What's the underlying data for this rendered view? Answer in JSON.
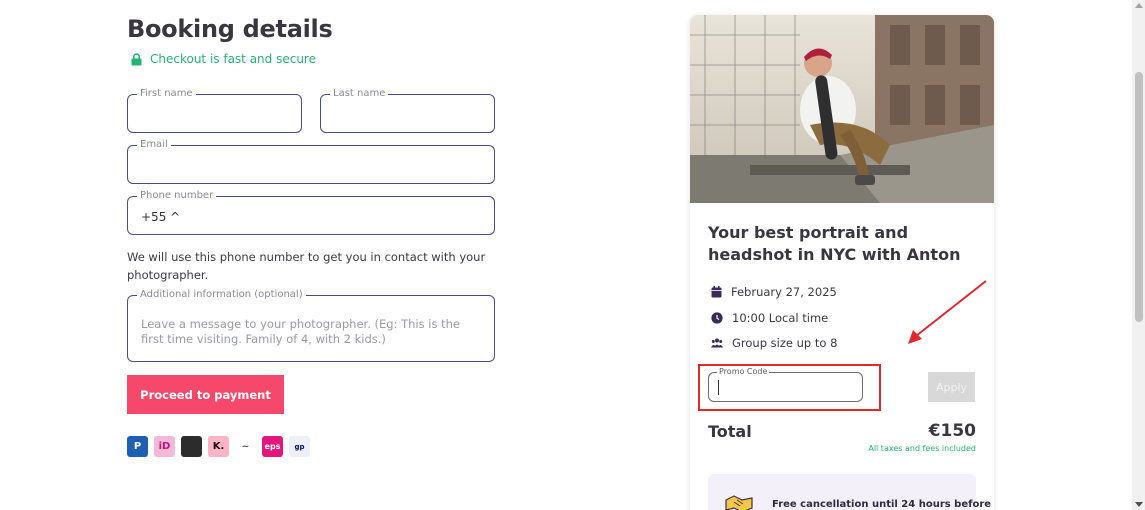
{
  "form": {
    "title": "Booking details",
    "secure_text": "Checkout is fast and secure",
    "first_name": {
      "label": "First name",
      "value": ""
    },
    "last_name": {
      "label": "Last name",
      "value": ""
    },
    "email": {
      "label": "Email",
      "value": ""
    },
    "phone": {
      "label": "Phone number",
      "country_code": "+55 ^"
    },
    "phone_helper": "We will use this phone number to get you in contact with your photographer.",
    "additional_info": {
      "label": "Additional information (optional)",
      "placeholder": "Leave a message to your photographer. (Eg: This is the first time visiting. Family of 4, with 2 kids.)"
    },
    "proceed_label": "Proceed to payment",
    "payment_methods": [
      {
        "name": "paypal-icon",
        "glyph": "P"
      },
      {
        "name": "ideal-icon",
        "glyph": "iD"
      },
      {
        "name": "card-icon",
        "glyph": ""
      },
      {
        "name": "klarna-icon",
        "glyph": "K."
      },
      {
        "name": "bancontact-icon",
        "glyph": "~"
      },
      {
        "name": "eps-icon",
        "glyph": "eps"
      },
      {
        "name": "giropay-icon",
        "glyph": "gp"
      }
    ]
  },
  "summary": {
    "title": "Your best portrait and headshot in NYC with Anton",
    "date": "February 27, 2025",
    "time": "10:00 Local time",
    "group": "Group size up to 8",
    "promo": {
      "label": "Promo Code",
      "value": ""
    },
    "apply_label": "Apply",
    "total_label": "Total",
    "total_price": "€150",
    "taxes_note": "All taxes and fees included",
    "cancellation": "Free cancellation until 24 hours before"
  },
  "colors": {
    "accent": "#f5486a",
    "secure_green": "#22b573",
    "field_border": "#4b4a8c",
    "icon_purple": "#3b2a5c",
    "annotation_red": "#e0282e"
  }
}
